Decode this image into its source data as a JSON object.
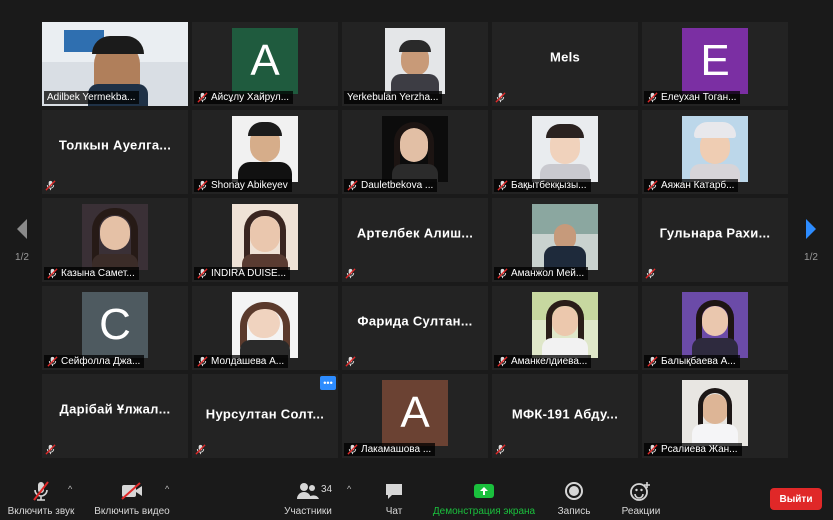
{
  "participants": [
    {
      "name": "Adilbek Yermekba...",
      "type": "video",
      "active": true,
      "muted": false
    },
    {
      "name": "Айсұлу Хайрул...",
      "type": "letter",
      "letter": "A",
      "color": "#1f5b3e",
      "muted": true
    },
    {
      "name": "Yerkebulan Yerzha...",
      "type": "video",
      "muted": false
    },
    {
      "name": "Mels",
      "type": "text",
      "muted": true
    },
    {
      "name": "Елеухан Тоган...",
      "type": "letter",
      "letter": "E",
      "color": "#7b2fa3",
      "muted": true
    },
    {
      "name": "Толкын Ауелга...",
      "type": "text",
      "muted": true
    },
    {
      "name": "Shonay Abikeyev",
      "type": "video",
      "muted": true
    },
    {
      "name": "Dauletbekova ...",
      "type": "video",
      "muted": true
    },
    {
      "name": "Бақытбекқызы...",
      "type": "video",
      "muted": true
    },
    {
      "name": "Аяжан Катарб...",
      "type": "video",
      "muted": true
    },
    {
      "name": "Казына Самет...",
      "type": "video",
      "muted": true
    },
    {
      "name": "INDIRA DUISE...",
      "type": "video",
      "muted": true
    },
    {
      "name": "Артелбек Алиш...",
      "type": "text",
      "muted": true
    },
    {
      "name": "Аманжол Мей...",
      "type": "video",
      "muted": true
    },
    {
      "name": "Гульнара Рахи...",
      "type": "text",
      "muted": true
    },
    {
      "name": "Сейфолла Джа...",
      "type": "letter",
      "letter": "C",
      "color": "#4e5a60",
      "muted": true
    },
    {
      "name": "Молдашева А...",
      "type": "video",
      "muted": true
    },
    {
      "name": "Фарида Султан...",
      "type": "text",
      "muted": true
    },
    {
      "name": "Аманкелдиева...",
      "type": "video",
      "muted": true
    },
    {
      "name": "Балықбаева А...",
      "type": "video",
      "muted": true
    },
    {
      "name": "Дарібай Ұлжал...",
      "type": "text",
      "muted": true
    },
    {
      "name": "Нурсултан Солт...",
      "type": "text",
      "muted": true,
      "more": true
    },
    {
      "name": "Лакамашова ...",
      "type": "letter",
      "letter": "A",
      "color": "#6b4233",
      "muted": true
    },
    {
      "name": "МФК-191 Абду...",
      "type": "text",
      "muted": true
    },
    {
      "name": "Рсалиева Жан...",
      "type": "video",
      "muted": true
    }
  ],
  "pager": {
    "left": "1/2",
    "right": "1/2"
  },
  "more_icon": "•••",
  "toolbar": {
    "audio": "Включить звук",
    "video": "Включить видео",
    "participants": "Участники",
    "participants_count": "34",
    "chat": "Чат",
    "share": "Демонстрация экрана",
    "record": "Запись",
    "reactions": "Реакции",
    "leave": "Выйти"
  },
  "colors": {
    "share_green": "#1ac03d",
    "leave_red": "#e02828",
    "active_border": "#c6e65a",
    "pager_arrow_right": "#2d8cff"
  }
}
